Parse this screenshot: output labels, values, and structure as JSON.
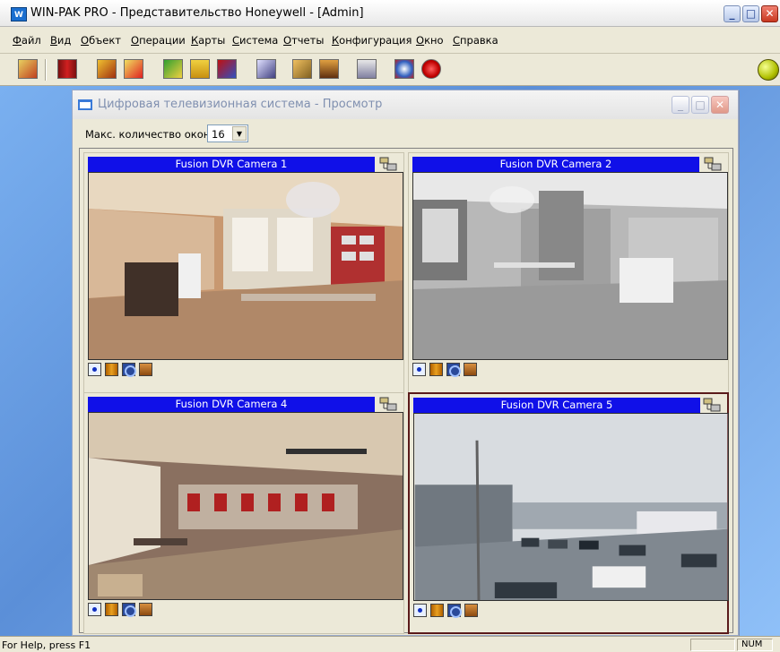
{
  "app": {
    "title": "WIN-PAK PRO - Представительство Honeywell - [Admin]",
    "icon_label": "W"
  },
  "menu": [
    "Файл",
    "Вид",
    "Объект",
    "Операции",
    "Карты",
    "Система",
    "Отчеты",
    "Конфигурация",
    "Окно",
    "Справка"
  ],
  "window_buttons": {
    "minimize": "_",
    "maximize": "□",
    "close": "✕"
  },
  "child_window": {
    "title": "Цифровая телевизионная система - Просмотр",
    "max_windows_label": "Макс. количество окон:",
    "max_windows_value": "16"
  },
  "cameras": [
    {
      "title": "Fusion DVR Camera 1"
    },
    {
      "title": "Fusion DVR Camera 2"
    },
    {
      "title": "Fusion DVR Camera 4"
    },
    {
      "title": "Fusion DVR Camera 5"
    }
  ],
  "status": {
    "help_text": "For Help, press F1",
    "indicator": "NUM"
  },
  "colors": {
    "camera_header": "#1010e8",
    "selected_border": "#5a1a1a",
    "desktop": "#6fa0e0"
  }
}
